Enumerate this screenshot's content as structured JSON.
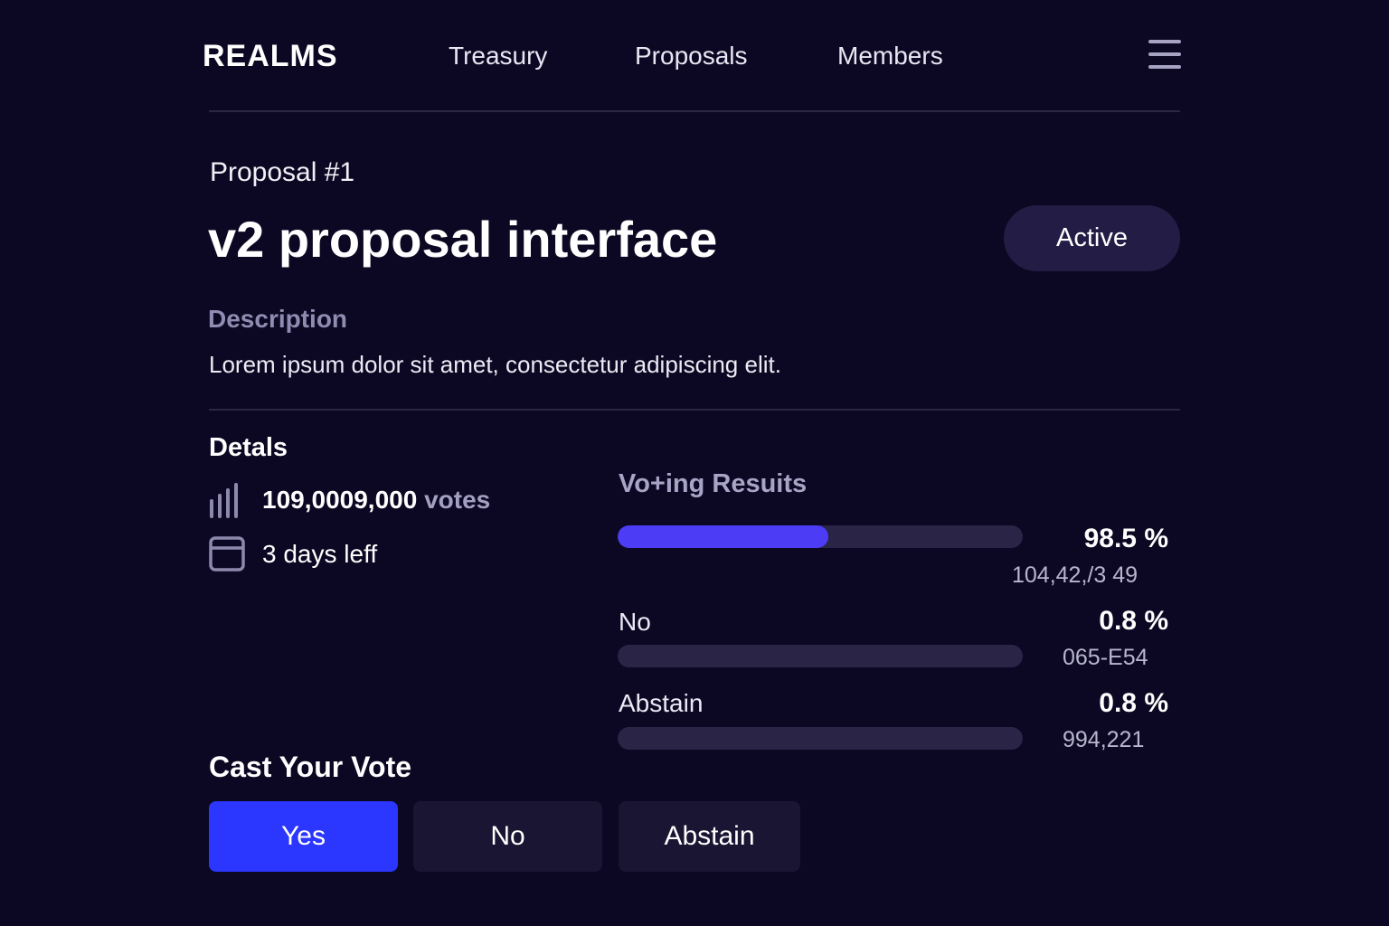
{
  "header": {
    "logo": "REALMS",
    "nav": {
      "treasury": "Treasury",
      "proposals": "Proposals",
      "members": "Members"
    },
    "menu_icon": "hamburger-menu-icon"
  },
  "proposal": {
    "number": "Proposal #1",
    "title": "v2 proposal interface",
    "status": "Active",
    "description_label": "Description",
    "description": "Lorem ipsum dolor sit amet, consectetur adipiscing elit."
  },
  "details": {
    "heading": "Detals",
    "votes_value": "109,0009,000",
    "votes_suffix": "votes",
    "votes_icon": "bar-chart-icon",
    "time_left": "3 days leff",
    "time_icon": "calendar-icon"
  },
  "results": {
    "heading": "Vo+ing Resuits",
    "yes": {
      "percent": "98.5 %",
      "count": "104,42,/3 49",
      "fill_fraction": 0.52
    },
    "no": {
      "label": "No",
      "percent": "0.8 %",
      "count": "065-E54",
      "fill_fraction": 0
    },
    "abstain": {
      "label": "Abstain",
      "percent": "0.8 %",
      "count": "994,221",
      "fill_fraction": 0
    },
    "colors": {
      "fill": "#4c3cf6",
      "track": "#2a2447"
    }
  },
  "vote": {
    "heading": "Cast Your Vote",
    "yes_label": "Yes",
    "no_label": "No",
    "abstain_label": "Abstain",
    "colors": {
      "primary": "#2b36ff",
      "secondary": "#1a1533"
    }
  }
}
